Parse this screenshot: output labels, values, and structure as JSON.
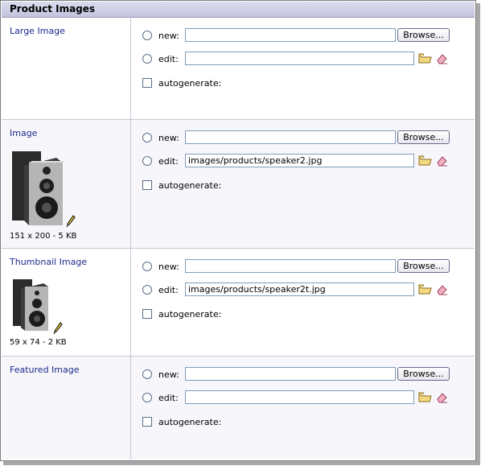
{
  "panel": {
    "title": "Product Images"
  },
  "labels": {
    "new": "new:",
    "edit": "edit:",
    "autogenerate": "autogenerate:",
    "browse": "Browse..."
  },
  "sections": [
    {
      "label": "Large Image",
      "edit_value": ""
    },
    {
      "label": "Image",
      "edit_value": "images/products/speaker2.jpg",
      "image_info": "151 x 200 - 5 KB"
    },
    {
      "label": "Thumbnail Image",
      "edit_value": "images/products/speaker2t.jpg",
      "image_info": "59 x 74 - 2 KB"
    },
    {
      "label": "Featured Image",
      "edit_value": ""
    }
  ]
}
